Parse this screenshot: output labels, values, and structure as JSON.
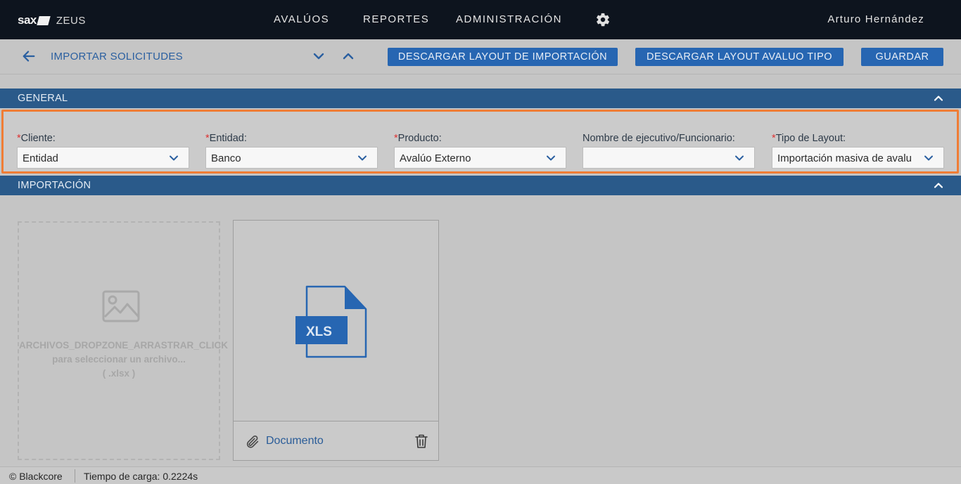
{
  "topbar": {
    "logo": "sax",
    "app_name": "ZEUS",
    "nav": [
      "AVALÚOS",
      "REPORTES",
      "ADMINISTRACIÓN"
    ],
    "user": "Arturo Hernández"
  },
  "toolbar": {
    "title": "IMPORTAR SOLICITUDES",
    "btn_layout": "DESCARGAR LAYOUT DE IMPORTACIÓN",
    "btn_layout_tipo": "DESCARGAR LAYOUT AVALUO TIPO",
    "btn_save": "GUARDAR"
  },
  "general": {
    "title": "GENERAL",
    "fields": [
      {
        "label": "Cliente:",
        "required": "*",
        "value": "Entidad"
      },
      {
        "label": "Entidad:",
        "required": "*",
        "value": "Banco"
      },
      {
        "label": "Producto:",
        "required": "*",
        "value": "Avalúo Externo"
      },
      {
        "label": "Nombre de ejecutivo/Funcionario:",
        "required": "",
        "value": ""
      },
      {
        "label": "Tipo de Layout:",
        "required": "*",
        "value": "Importación masiva de avalu"
      }
    ]
  },
  "import": {
    "title": "IMPORTACIÓN",
    "dropzone_line1": "ARCHIVOS_DROPZONE_ARRASTRAR_CLICK",
    "dropzone_line2": "para seleccionar un archivo...",
    "dropzone_line3": "( .xlsx )",
    "file_badge": "XLS",
    "file_label": "Documento"
  },
  "footer": {
    "copyright": "© Blackcore",
    "load_time": "Tiempo de carga: 0.2224s"
  },
  "colors": {
    "topbar_bg": "#0d141e",
    "accent": "#2766b2",
    "section_bg": "#2a5a8a",
    "highlight": "#f07d35"
  }
}
